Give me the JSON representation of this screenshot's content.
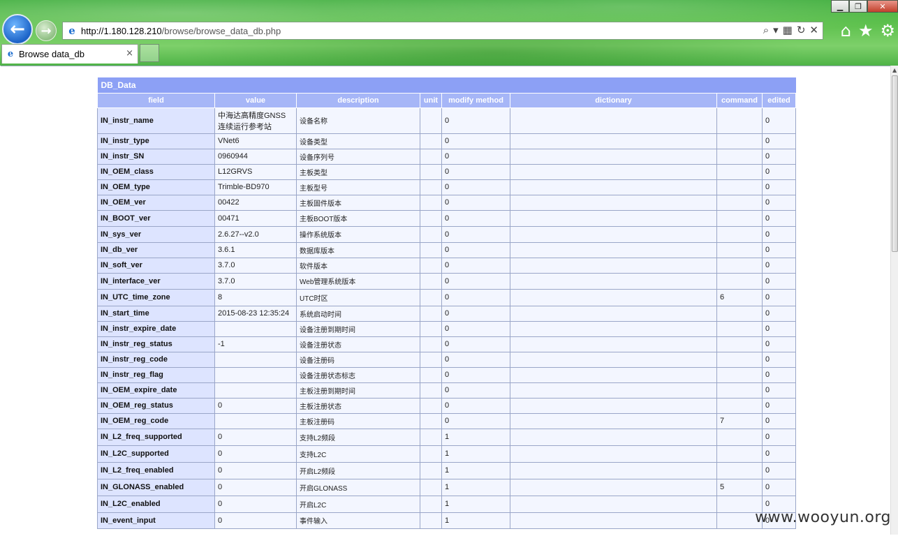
{
  "browser": {
    "window_buttons": [
      "▁",
      "❐",
      "✕"
    ],
    "back_glyph": "←",
    "forward_glyph": "→",
    "url_host": "http://1.180.128.210",
    "url_path": "/browse/browse_data_db.php",
    "addr_tools": [
      "⌕",
      "▾",
      "▦",
      "↻",
      "✕"
    ],
    "right_tools": [
      "⌂",
      "★",
      "⚙"
    ],
    "tab_title": "Browse data_db",
    "tab_close": "×"
  },
  "table": {
    "caption": "DB_Data",
    "columns": [
      "field",
      "value",
      "description",
      "unit",
      "modify method",
      "dictionary",
      "command",
      "edited"
    ],
    "rows": [
      {
        "field": "IN_instr_name",
        "value": "中海达高精度GNSS连续运行参考站",
        "description": "设备名称",
        "unit": "",
        "modify": "0",
        "dictionary": "",
        "command": "",
        "edited": "0"
      },
      {
        "field": "IN_instr_type",
        "value": "VNet6",
        "description": "设备类型",
        "unit": "",
        "modify": "0",
        "dictionary": "",
        "command": "",
        "edited": "0"
      },
      {
        "field": "IN_instr_SN",
        "value": "0960944",
        "description": "设备序列号",
        "unit": "",
        "modify": "0",
        "dictionary": "",
        "command": "",
        "edited": "0"
      },
      {
        "field": "IN_OEM_class",
        "value": "L12GRVS",
        "description": "主板类型",
        "unit": "",
        "modify": "0",
        "dictionary": "",
        "command": "",
        "edited": "0"
      },
      {
        "field": "IN_OEM_type",
        "value": "Trimble-BD970",
        "description": "主板型号",
        "unit": "",
        "modify": "0",
        "dictionary": "",
        "command": "",
        "edited": "0"
      },
      {
        "field": "IN_OEM_ver",
        "value": "00422",
        "description": "主板固件版本",
        "unit": "",
        "modify": "0",
        "dictionary": "",
        "command": "",
        "edited": "0"
      },
      {
        "field": "IN_BOOT_ver",
        "value": "00471",
        "description": "主板BOOT版本",
        "unit": "",
        "modify": "0",
        "dictionary": "",
        "command": "",
        "edited": "0"
      },
      {
        "field": "IN_sys_ver",
        "value": "2.6.27--v2.0",
        "description": "操作系统版本",
        "unit": "",
        "modify": "0",
        "dictionary": "",
        "command": "",
        "edited": "0"
      },
      {
        "field": "IN_db_ver",
        "value": "3.6.1",
        "description": "数据库版本",
        "unit": "",
        "modify": "0",
        "dictionary": "",
        "command": "",
        "edited": "0"
      },
      {
        "field": "IN_soft_ver",
        "value": "3.7.0",
        "description": "软件版本",
        "unit": "",
        "modify": "0",
        "dictionary": "",
        "command": "",
        "edited": "0"
      },
      {
        "field": "IN_interface_ver",
        "value": "3.7.0",
        "description": "Web管理系统版本",
        "unit": "",
        "modify": "0",
        "dictionary": "",
        "command": "",
        "edited": "0"
      },
      {
        "field": "IN_UTC_time_zone",
        "value": "8",
        "description": "UTC时区",
        "unit": "",
        "modify": "0",
        "dictionary": "",
        "command": "6",
        "edited": "0"
      },
      {
        "field": "IN_start_time",
        "value": "2015-08-23 12:35:24",
        "description": "系统启动时间",
        "unit": "",
        "modify": "0",
        "dictionary": "",
        "command": "",
        "edited": "0"
      },
      {
        "field": "IN_instr_expire_date",
        "value": "",
        "description": "设备注册到期时间",
        "unit": "",
        "modify": "0",
        "dictionary": "",
        "command": "",
        "edited": "0"
      },
      {
        "field": "IN_instr_reg_status",
        "value": "-1",
        "description": "设备注册状态",
        "unit": "",
        "modify": "0",
        "dictionary": "",
        "command": "",
        "edited": "0"
      },
      {
        "field": "IN_instr_reg_code",
        "value": "",
        "description": "设备注册码",
        "unit": "",
        "modify": "0",
        "dictionary": "",
        "command": "",
        "edited": "0"
      },
      {
        "field": "IN_instr_reg_flag",
        "value": "",
        "description": "设备注册状态标志",
        "unit": "",
        "modify": "0",
        "dictionary": "",
        "command": "",
        "edited": "0"
      },
      {
        "field": "IN_OEM_expire_date",
        "value": "",
        "description": "主板注册到期时间",
        "unit": "",
        "modify": "0",
        "dictionary": "",
        "command": "",
        "edited": "0"
      },
      {
        "field": "IN_OEM_reg_status",
        "value": "0",
        "description": "主板注册状态",
        "unit": "",
        "modify": "0",
        "dictionary": "",
        "command": "",
        "edited": "0"
      },
      {
        "field": "IN_OEM_reg_code",
        "value": "",
        "description": "主板注册码",
        "unit": "",
        "modify": "0",
        "dictionary": "",
        "command": "7",
        "edited": "0"
      },
      {
        "field": "IN_L2_freq_supported",
        "value": "0",
        "description": "支持L2频段",
        "unit": "",
        "modify": "1",
        "dictionary": "",
        "command": "",
        "edited": "0"
      },
      {
        "field": "IN_L2C_supported",
        "value": "0",
        "description": "支持L2C",
        "unit": "",
        "modify": "1",
        "dictionary": "",
        "command": "",
        "edited": "0"
      },
      {
        "field": "IN_L2_freq_enabled",
        "value": "0",
        "description": "开启L2频段",
        "unit": "",
        "modify": "1",
        "dictionary": "",
        "command": "",
        "edited": "0"
      },
      {
        "field": "IN_GLONASS_enabled",
        "value": "0",
        "description": "开启GLONASS",
        "unit": "",
        "modify": "1",
        "dictionary": "",
        "command": "5",
        "edited": "0"
      },
      {
        "field": "IN_L2C_enabled",
        "value": "0",
        "description": "开启L2C",
        "unit": "",
        "modify": "1",
        "dictionary": "",
        "command": "",
        "edited": "0"
      },
      {
        "field": "IN_event_input",
        "value": "0",
        "description": "事件输入",
        "unit": "",
        "modify": "1",
        "dictionary": "",
        "command": "",
        "edited": "0"
      }
    ]
  },
  "watermark": "www.wooyun.org"
}
